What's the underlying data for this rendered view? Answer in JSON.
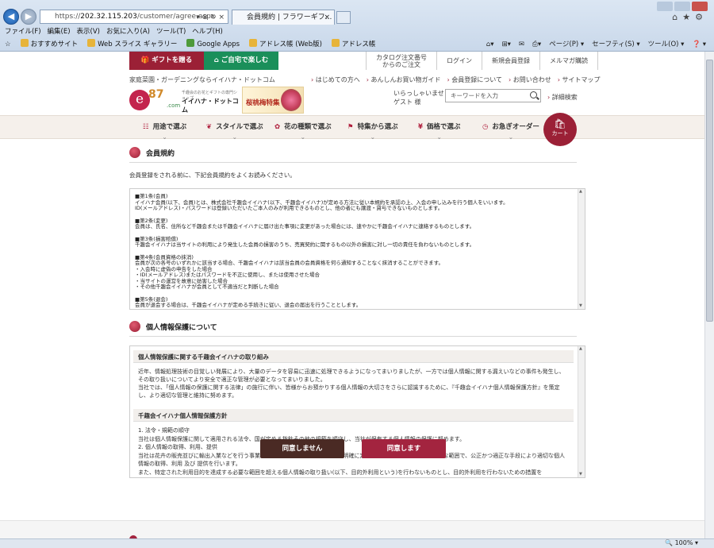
{
  "browser": {
    "url_prefix": "https://",
    "url_host": "202.32.115.203",
    "url_path": "/customer/agree.aspx",
    "address_tools": "▾ ⊗ ↻ ×",
    "tab_title": "会員規約 | フラワーギフ...",
    "menu": [
      "ファイル(F)",
      "編集(E)",
      "表示(V)",
      "お気に入り(A)",
      "ツール(T)",
      "ヘルプ(H)"
    ],
    "favorites": [
      "おすすめサイト",
      "Web スライス ギャラリー",
      "Google Apps",
      "アドレス帳 (Web版)",
      "アドレス帳"
    ],
    "commands": [
      "ページ(P) ▾",
      "セーフティ(S) ▾",
      "ツール(O) ▾",
      "❓ ▾"
    ],
    "zoom": "100%"
  },
  "header": {
    "gift_label": "ギフトを贈る",
    "home_label": "ご自宅で楽しむ",
    "top_links": [
      "カタログ注文番号\nからのご注文",
      "ログイン",
      "新規会員登録",
      "メルマガ購読"
    ],
    "tagline": "家庭菜園・ガーデニングならイイハナ・ドットコム",
    "util_links": [
      "はじめての方へ",
      "あんしんお買い物ガイド",
      "会員登録について",
      "お問い合わせ",
      "サイトマップ"
    ],
    "logo": {
      "e": "e",
      "num": "87",
      "com": ".com",
      "sub": "千趣会のお花とギフトの専門ショップ",
      "name": "イイハナ・ドットコム"
    },
    "banner": "桜桃梅特集",
    "greeting_line1": "いらっしゃいませ",
    "greeting_line2": "ゲスト 様",
    "search_placeholder": "キーワードを入力",
    "detail_search": "詳細検索"
  },
  "nav": [
    {
      "label": "用途で選ぶ",
      "icon": "☷"
    },
    {
      "label": "スタイルで選ぶ",
      "icon": "❦"
    },
    {
      "label": "花の種類で選ぶ",
      "icon": "✿"
    },
    {
      "label": "特集から選ぶ",
      "icon": "⚑"
    },
    {
      "label": "価格で選ぶ",
      "icon": "¥"
    },
    {
      "label": "お急ぎオーダー",
      "icon": "◷"
    }
  ],
  "cart_label": "カート",
  "terms_section": {
    "title": "会員規約",
    "intro": "会員登録をされる前に、下記会員規約をよくお読みください。",
    "articles": [
      "■第1条(会員)\nイイハナ会員(以下、会員)とは、株式会社千趣会イイハナ(以下、千趣会イイハナ)が定める方法に従い本規約を承認の上、入会の申し込みを行う個人をいいます。\nID(メールアドレス)・パスワードは登録いただいたご本人のみが利用できるものとし、他の者にも譲渡・貸与できないものとします。",
      "■第2条(変更)\n会員は、氏名、住所など千趣会または千趣会イイハナに届け出た事項に変更があった場合には、速やかに千趣会イイハナに連絡するものとします。",
      "■第3条(損害賠償)\n千趣会イイハナは当サイトの利用により発生した会員の損害のうち、売買契約に関するもの以外の損害に対し一切の責任を負わないものとします。",
      "■第4条(会員資格の抹消)\n会員が次の各号のいずれかに該当する場合、千趣会イイハナは該当会員の会員資格を何ら通知することなく抹消することができます。\n・入会時に虚偽の申告をした場合\n・ID(メールアドレス)またはパスワードを不正に使用し、または使用させた場合\n・当サイトの運営を故意に妨害した場合\n・その他千趣会イイハナが会員として不適当だと判断した場合",
      "■第5条(退会)\n会員が退会する場合は、千趣会イイハナが定める手続きに従い、退会の届出を行うこととします。"
    ]
  },
  "privacy_section": {
    "title": "個人情報保護について",
    "head1": "個人情報保護に関する千趣会イイハナの取り組み",
    "body1": "近年、情報処理技術の目覚しい発展により、大量のデータを容易に迅速に処理できるようになってまいりましたが、一方では個人情報に関する漏えいなどの事件も発生し、その取り扱いについてより安全で適正な管理が必要となってまいりました。\n当社では、「個人情報の保護に関する法律」の施行に伴い、皆様からお預かりする個人情報の大切さをさらに認識するために、『千趣会イイハナ個人情報保護方針』を策定し、より適切な管理と維持に努めます。",
    "head2": "千趣会イイハナ個人情報保護方針",
    "list": "1. 法令・規範の順守\n   当社は個人情報保護に関して適用される法令、国が定める指針その他の規範を順守し、当社が保有する個人情報の保護に努めます。\n2. 個人情報の取得、利用、提供\n   当社は花卉の販売並びに輸出入業などを行う事業者として、個人情報の利用目的を明確に定め、その目的達成のために必要な範囲で、公正かつ適正な手段により適切な個人情報の取得、利用 及び 提供を行います。\n   また、特定された利用目的を達成する必要な範囲を超える個人情報の取り扱い(以下、目的外利用という)を行わないものとし、目的外利用を行わないための措置を"
  },
  "buttons": {
    "disagree": "同意しません",
    "agree": "同意します"
  }
}
